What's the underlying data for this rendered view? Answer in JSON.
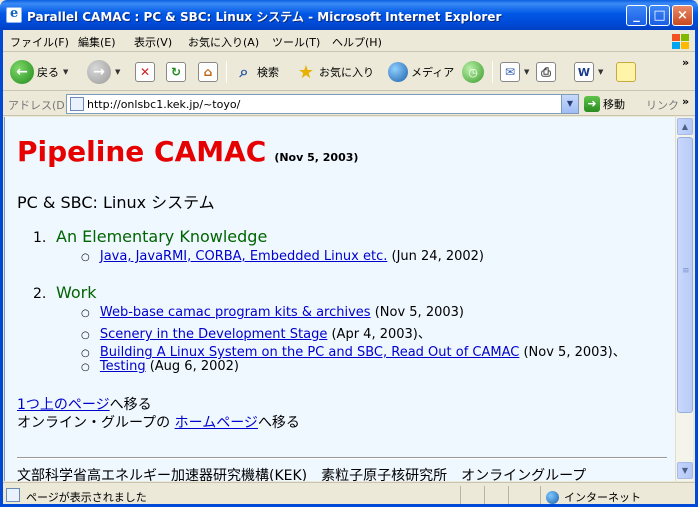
{
  "window": {
    "title": "Parallel CAMAC : PC & SBC: Linux システム - Microsoft Internet Explorer",
    "minimize_glyph": "_",
    "maximize_glyph": "□",
    "close_glyph": "×"
  },
  "menu": [
    "ファイル(F)",
    "編集(E)",
    "表示(V)",
    "お気に入り(A)",
    "ツール(T)",
    "ヘルプ(H)"
  ],
  "toolbar": {
    "back_label": "戻る",
    "search_label": "検索",
    "favorites_label": "お気に入り",
    "media_label": "メディア",
    "more_glyph": "»"
  },
  "address": {
    "label": "アドレス(D)",
    "url": "http://onlsbc1.kek.jp/~toyo/",
    "go_label": "移動",
    "links_label": "リンク"
  },
  "page": {
    "heading": "Pipeline CAMAC",
    "heading_date": "(Nov 5, 2003)",
    "subtitle": "PC & SBC: Linux システム",
    "sections": [
      {
        "num": "1.",
        "title": "An Elementary Knowledge",
        "items": [
          {
            "link": "Java, JavaRMI, CORBA, Embedded Linux etc.",
            "suffix": " (Jun 24, 2002)"
          }
        ]
      },
      {
        "num": "2.",
        "title": "Work",
        "items": [
          {
            "link": "Web-base camac program kits & archives",
            "suffix": " (Nov 5, 2003)"
          },
          {
            "link": "Scenery in the Development Stage",
            "suffix": " (Apr 4, 2003)、"
          },
          {
            "link": "Building A Linux System on the PC and SBC, Read Out of CAMAC",
            "suffix": " (Nov 5, 2003)、"
          },
          {
            "link": "Testing",
            "suffix": " (Aug 6, 2002)"
          }
        ]
      }
    ],
    "nav": {
      "up_link": "1つ上のページ",
      "up_suffix": "へ移る",
      "home_prefix": "オンライン・グループの ",
      "home_link": "ホームページ",
      "home_suffix": "へ移る"
    },
    "footer": "文部科学省高エネルギー加速器研究機構(KEK)　素粒子原子核研究所　オンライングループ"
  },
  "status": {
    "text": "ページが表示されました",
    "zone": "インターネット"
  },
  "colors": {
    "heading": "#E60000",
    "section_title": "#006400",
    "link": "#0000CC",
    "content_bg": "#EFF7FF"
  }
}
